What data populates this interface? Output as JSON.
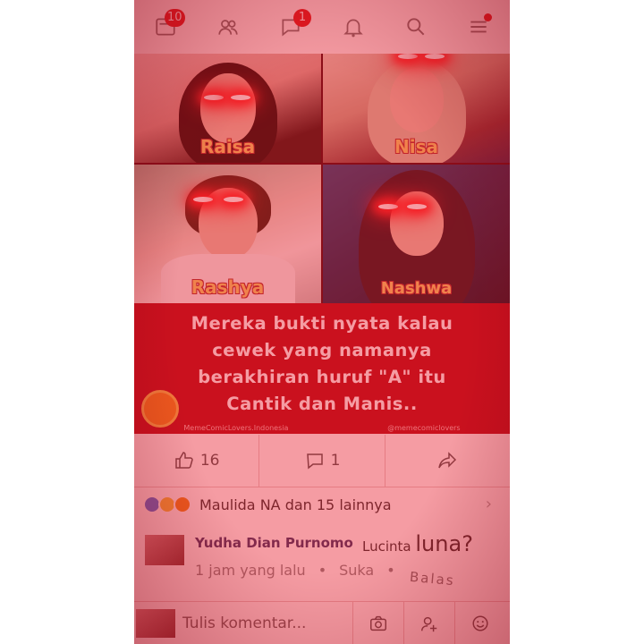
{
  "topbar": {
    "news_badge": "10",
    "messages_badge": "1"
  },
  "post": {
    "tiles": [
      {
        "name": "Raisa"
      },
      {
        "name": "Nisa"
      },
      {
        "name": "Rashya"
      },
      {
        "name": "Nashwa"
      }
    ],
    "caption": "Mereka bukti nyata kalau\ncewek yang namanya\nberakhiran huruf \"A\" itu\nCantik dan Manis..",
    "watermark_left": "MemeComicLovers.Indonesia",
    "watermark_right": "@memecomiclovers"
  },
  "actions": {
    "like_count": "16",
    "comment_count": "1"
  },
  "reactions": {
    "text": "Maulida NA dan 15 lainnya"
  },
  "comment": {
    "author": "Yudha Dian Purnomo",
    "text_prefix": "Lucinta",
    "text_big": "luna?",
    "time": "1 jam yang lalu",
    "sep": "•",
    "like_label": "Suka",
    "reply_label": "Balas"
  },
  "composer": {
    "placeholder": "Tulis komentar..."
  },
  "colors": {
    "overlay": "#e61423",
    "badge": "#e02020",
    "caption_bg": "#b5101a",
    "name_text": "#f7d36a"
  },
  "icons": [
    "news-feed-icon",
    "friends-icon",
    "messages-icon",
    "notifications-icon",
    "search-icon",
    "menu-icon",
    "like-icon",
    "comment-icon",
    "share-icon",
    "camera-icon",
    "tag-person-icon",
    "emoji-icon"
  ]
}
